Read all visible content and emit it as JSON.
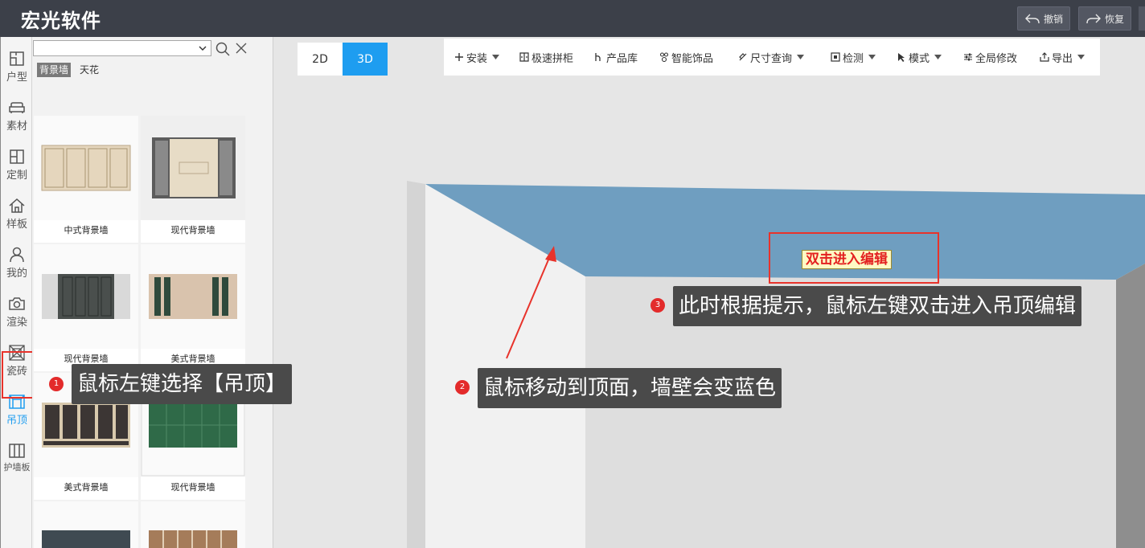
{
  "app": {
    "title": "宏光软件"
  },
  "top_actions": {
    "undo": "撤销",
    "redo": "恢复"
  },
  "sidebar": {
    "items": [
      {
        "label": "户型",
        "icon": "floorplan-icon"
      },
      {
        "label": "素材",
        "icon": "sofa-icon"
      },
      {
        "label": "定制",
        "icon": "cabinet-icon"
      },
      {
        "label": "样板",
        "icon": "house-icon"
      },
      {
        "label": "我的",
        "icon": "user-icon"
      },
      {
        "label": "渲染",
        "icon": "camera-icon"
      },
      {
        "label": "瓷砖",
        "icon": "tile-icon"
      },
      {
        "label": "吊顶",
        "icon": "ceiling-icon",
        "active": true
      },
      {
        "label": "护墙板",
        "icon": "wall-panel-icon"
      }
    ]
  },
  "catalog": {
    "search_value": "",
    "subtabs": [
      "背景墙",
      "天花"
    ],
    "active_subtab": "背景墙",
    "items": [
      {
        "name": "中式背景墙"
      },
      {
        "name": "现代背景墙"
      },
      {
        "name": "现代背景墙"
      },
      {
        "name": "美式背景墙"
      },
      {
        "name": "美式背景墙"
      },
      {
        "name": "现代背景墙"
      }
    ]
  },
  "view_modes": {
    "mode_2d": "2D",
    "mode_3d": "3D",
    "active": "3D"
  },
  "toolbar": {
    "items": [
      {
        "label": "安装",
        "icon": "plus-icon",
        "dropdown": true
      },
      {
        "label": "极速拼柜",
        "icon": "cabinet-icon",
        "dropdown": false
      },
      {
        "label": "产品库",
        "icon": "product-icon",
        "dropdown": false
      },
      {
        "label": "智能饰品",
        "icon": "decor-icon",
        "dropdown": false
      },
      {
        "label": "尺寸查询",
        "icon": "ruler-icon",
        "dropdown": true
      },
      {
        "label": "检测",
        "icon": "check-icon",
        "dropdown": true
      },
      {
        "label": "模式",
        "icon": "cursor-icon",
        "dropdown": true
      },
      {
        "label": "全局修改",
        "icon": "sliders-icon",
        "dropdown": false
      },
      {
        "label": "导出",
        "icon": "export-icon",
        "dropdown": true
      }
    ]
  },
  "scene": {
    "edit_hint": "双击进入编辑",
    "ceiling_color": "#6f9ec0"
  },
  "callouts": {
    "step1": {
      "num": "1",
      "text": "鼠标左键选择【吊顶】"
    },
    "step2": {
      "num": "2",
      "text": "鼠标移动到顶面，墙壁会变蓝色"
    },
    "step3": {
      "num": "3",
      "text": "此时根据提示，鼠标左键双击进入吊顶编辑"
    }
  },
  "colors": {
    "accent": "#1e9df0",
    "highlight": "#e8332b",
    "topbar": "#3c4049"
  }
}
